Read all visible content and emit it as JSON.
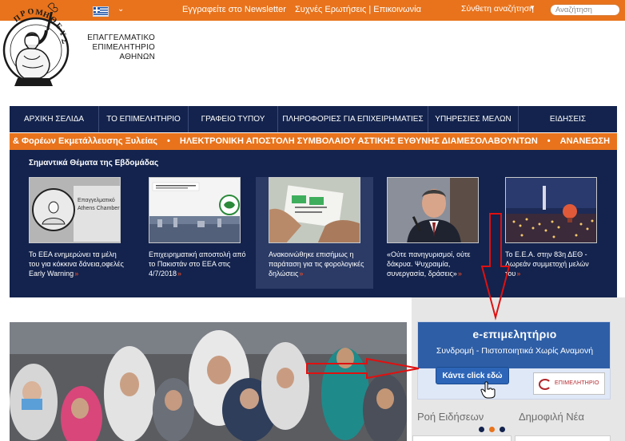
{
  "topbar": {
    "language_flag": "greek-flag-icon",
    "newsletter": "Εγγραφείτε στο Newsletter",
    "faq_contact": "Συχνές Ερωτήσεις | Επικοινωνία",
    "advanced_search": "Σύνθετη αναζήτηση",
    "search_placeholder": "Αναζήτηση"
  },
  "logo": {
    "line1": "ΕΠΑΓΓΕΛΜΑΤΙΚΟ",
    "line2": "ΕΠΙΜΕΛΗΤΗΡΙΟ",
    "line3": "ΑΘΗΝΩΝ"
  },
  "nav": [
    {
      "label": "ΑΡΧΙΚΗ ΣΕΛΙΔΑ"
    },
    {
      "label": "ΤΟ ΕΠΙΜΕΛΗΤΗΡΙΟ"
    },
    {
      "label": "ΓΡΑΦΕΙΟ ΤΥΠΟΥ"
    },
    {
      "label": "ΠΛΗΡΟΦΟΡΙΕΣ ΓΙΑ ΕΠΙΧΕΙΡΗΜΑΤΙΕΣ"
    },
    {
      "label": "ΥΠΗΡΕΣΙΕΣ ΜΕΛΩΝ"
    },
    {
      "label": "ΕΙΔΗΣΕΙΣ"
    }
  ],
  "ticker": {
    "item1": "& Φορέων Εκμετάλλευσης Ξυλείας",
    "item2": "ΗΛΕΚΤΡΟΝΙΚΗ ΑΠΟΣΤΟΛΗ ΣΥΜΒΟΛΑΙΟΥ ΑΣΤΙΚΗΣ ΕΥΘΥΝΗΣ ΔΙΑΜΕΣΟΛΑΒΟΥΝΤΩΝ",
    "item3": "ΑΝΑΝΕΩΣΗ",
    "separator": "•"
  },
  "weekly": {
    "title": "Σημαντικά Θέματα της Εβδομάδας",
    "more_marker": "»",
    "cards": [
      {
        "caption": "Το ΕΕΑ ενημερώνει τα μέλη του για κόκκινα δάνεια,οφελές Early Warning"
      },
      {
        "caption": "Επιχειρηματική αποστολή από το Πακιστάν στο ΕΕΑ στις 4/7/2018"
      },
      {
        "caption": "Ανακοινώθηκε επισήμως η παράταση για τις φορολογικές δηλώσεις"
      },
      {
        "caption": "«Ούτε πανηγυρισμοί, ούτε δάκρυα. Ψυχραιμία, συνεργασία, δράσεις»"
      },
      {
        "caption": "Το Ε.Ε.Α. στην 83η ΔΕΘ - Δωρεάν συμμετοχή μελών του"
      }
    ]
  },
  "ebanner": {
    "title": "e-επιμελητήριο",
    "subtitle": "Συνδρομή - Πιστοποιητικά  Χωρίς Αναμονή",
    "button": "Κάντε click εδώ",
    "logo_text": "ΕΠΙΜΕΛΗΤΗΡΙΟ"
  },
  "sidebar_tabs": {
    "news_feed": "Ροή Ειδήσεων",
    "popular": "Δημοφιλή Νέα"
  },
  "colors": {
    "orange": "#e8731c",
    "navy": "#13234d",
    "annotation_red": "#e01010",
    "more_arrow": "#ff4f25"
  }
}
